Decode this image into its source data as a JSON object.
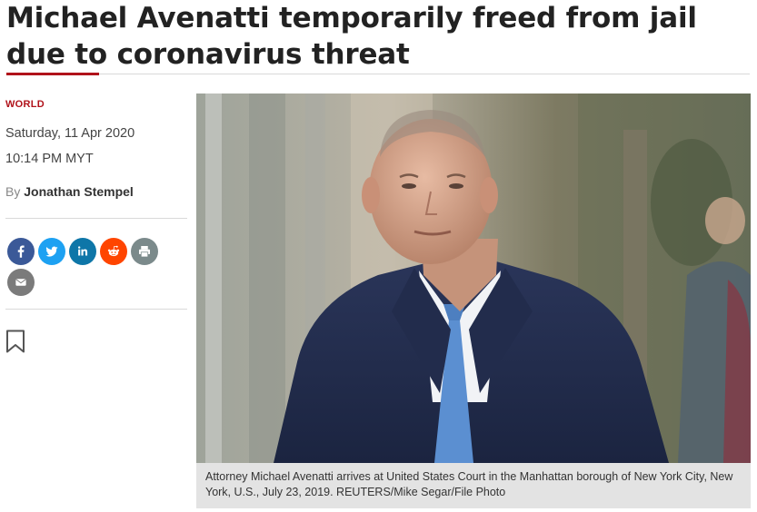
{
  "article": {
    "headline": "Michael Avenatti temporarily freed from jail due to coronavirus threat",
    "section": "WORLD",
    "date": "Saturday, 11 Apr 2020",
    "time": "10:14 PM MYT",
    "byline_prefix": "By",
    "author": "Jonathan Stempel",
    "caption": "Attorney Michael Avenatti arrives at United States Court in the Manhattan borough of New York City, New York, U.S., July 23, 2019. REUTERS/Mike Segar/File Photo"
  },
  "share": {
    "buttons": [
      {
        "icon": "facebook-icon",
        "color": "#3b5998"
      },
      {
        "icon": "twitter-icon",
        "color": "#1da1f2"
      },
      {
        "icon": "linkedin-icon",
        "color": "#0e76a8"
      },
      {
        "icon": "reddit-icon",
        "color": "#ff4500"
      },
      {
        "icon": "print-icon",
        "color": "#7b8a8b"
      },
      {
        "icon": "email-icon",
        "color": "#7b7b7b"
      }
    ]
  },
  "colors": {
    "accent": "#b0121a",
    "caption_bg": "#e3e3e3"
  }
}
